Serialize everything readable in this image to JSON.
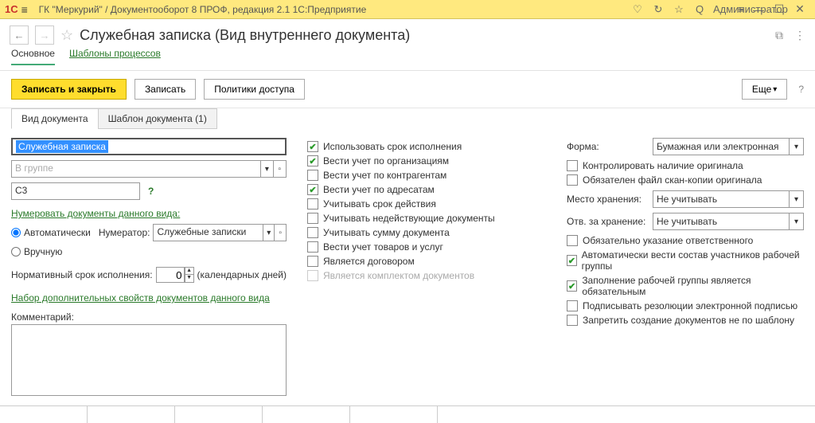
{
  "titlebar": {
    "logo": "1C",
    "title": "ГК \"Меркурий\" / Документооборот 8 ПРОФ, редакция 2.1 1С:Предприятие",
    "user": "Администратор"
  },
  "header": {
    "title": "Служебная записка (Вид внутреннего документа)"
  },
  "subnav": {
    "main": "Основное",
    "templates": "Шаблоны процессов"
  },
  "toolbar": {
    "save_close": "Записать и закрыть",
    "save": "Записать",
    "access_policies": "Политики доступа",
    "more": "Еще"
  },
  "tabs": {
    "doc_type": "Вид документа",
    "doc_template": "Шаблон документа (1)"
  },
  "left": {
    "name_value": "Служебная записка",
    "group_placeholder": "В группе",
    "index_value": "С3",
    "numbering_title": "Нумеровать документы данного вида:",
    "auto_label": "Автоматически",
    "numerator_label": "Нумератор:",
    "numerator_value": "Служебные записки",
    "manual_label": "Вручную",
    "norm_term_label": "Нормативный срок исполнения:",
    "norm_term_value": "0",
    "norm_term_unit": "(календарных дней)",
    "extra_props_link": "Набор дополнительных свойств документов данного вида",
    "comment_label": "Комментарий:"
  },
  "mid": {
    "items": [
      {
        "label": "Использовать срок исполнения",
        "checked": true
      },
      {
        "label": "Вести учет по организациям",
        "checked": true
      },
      {
        "label": "Вести учет по контрагентам",
        "checked": false
      },
      {
        "label": "Вести учет по адресатам",
        "checked": true
      },
      {
        "label": "Учитывать срок действия",
        "checked": false
      },
      {
        "label": "Учитывать недействующие документы",
        "checked": false
      },
      {
        "label": "Учитывать сумму документа",
        "checked": false
      },
      {
        "label": "Вести учет товаров и услуг",
        "checked": false
      },
      {
        "label": "Является договором",
        "checked": false
      },
      {
        "label": "Является комплектом документов",
        "checked": false,
        "disabled": true
      }
    ]
  },
  "right": {
    "form_label": "Форма:",
    "form_value": "Бумажная или электронная",
    "storage_label": "Место хранения:",
    "storage_value": "Не учитывать",
    "resp_label": "Отв. за хранение:",
    "resp_value": "Не учитывать",
    "checks_top": [
      {
        "label": "Контролировать наличие оригинала",
        "checked": false
      },
      {
        "label": "Обязателен файл скан-копии оригинала",
        "checked": false
      }
    ],
    "checks_bottom": [
      {
        "label": "Обязательно указание ответственного",
        "checked": false
      },
      {
        "label": "Автоматически вести состав участников рабочей группы",
        "checked": true
      },
      {
        "label": "Заполнение рабочей группы является обязательным",
        "checked": true
      },
      {
        "label": "Подписывать резолюции электронной подписью",
        "checked": false
      },
      {
        "label": "Запретить создание документов не по шаблону",
        "checked": false
      }
    ]
  }
}
